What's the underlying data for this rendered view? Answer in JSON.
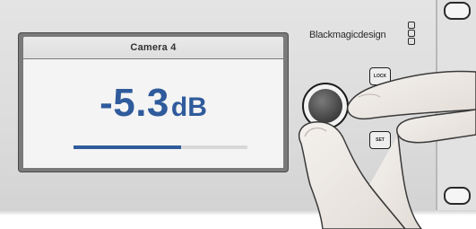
{
  "display": {
    "channel_title": "Camera 4",
    "level_value": "-5.3",
    "level_unit": "dB",
    "level_meter_fraction": 0.62
  },
  "brand": {
    "name": "Blackmagicdesign"
  },
  "controls": {
    "lock_label": "LOCK",
    "set_label": "SET"
  },
  "colors": {
    "accent": "#2f5b9c",
    "panel": "#dcdcdc"
  },
  "icons": {
    "knob": "rotary-knob-icon",
    "logo": "blackmagic-logo-icon",
    "rack_slot": "rack-mount-slot-icon"
  }
}
